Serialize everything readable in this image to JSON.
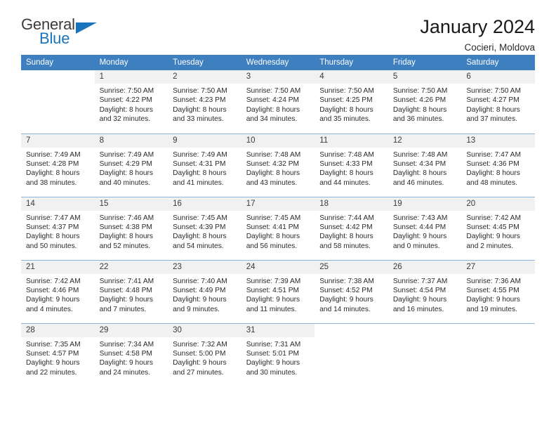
{
  "logo": {
    "word1": "General",
    "word2": "Blue",
    "triangle_color": "#1a74bb"
  },
  "header": {
    "title": "January 2024",
    "subtitle": "Cocieri, Moldova",
    "header_bg": "#3d7fbf",
    "daynum_bg": "#f1f1f1"
  },
  "weekdays": [
    "Sunday",
    "Monday",
    "Tuesday",
    "Wednesday",
    "Thursday",
    "Friday",
    "Saturday"
  ],
  "weeks": [
    [
      {
        "day": "",
        "blank": true,
        "sunrise": "",
        "sunset": "",
        "daylight1": "",
        "daylight2": ""
      },
      {
        "day": "1",
        "sunrise": "Sunrise: 7:50 AM",
        "sunset": "Sunset: 4:22 PM",
        "daylight1": "Daylight: 8 hours",
        "daylight2": "and 32 minutes."
      },
      {
        "day": "2",
        "sunrise": "Sunrise: 7:50 AM",
        "sunset": "Sunset: 4:23 PM",
        "daylight1": "Daylight: 8 hours",
        "daylight2": "and 33 minutes."
      },
      {
        "day": "3",
        "sunrise": "Sunrise: 7:50 AM",
        "sunset": "Sunset: 4:24 PM",
        "daylight1": "Daylight: 8 hours",
        "daylight2": "and 34 minutes."
      },
      {
        "day": "4",
        "sunrise": "Sunrise: 7:50 AM",
        "sunset": "Sunset: 4:25 PM",
        "daylight1": "Daylight: 8 hours",
        "daylight2": "and 35 minutes."
      },
      {
        "day": "5",
        "sunrise": "Sunrise: 7:50 AM",
        "sunset": "Sunset: 4:26 PM",
        "daylight1": "Daylight: 8 hours",
        "daylight2": "and 36 minutes."
      },
      {
        "day": "6",
        "sunrise": "Sunrise: 7:50 AM",
        "sunset": "Sunset: 4:27 PM",
        "daylight1": "Daylight: 8 hours",
        "daylight2": "and 37 minutes."
      }
    ],
    [
      {
        "day": "7",
        "sunrise": "Sunrise: 7:49 AM",
        "sunset": "Sunset: 4:28 PM",
        "daylight1": "Daylight: 8 hours",
        "daylight2": "and 38 minutes."
      },
      {
        "day": "8",
        "sunrise": "Sunrise: 7:49 AM",
        "sunset": "Sunset: 4:29 PM",
        "daylight1": "Daylight: 8 hours",
        "daylight2": "and 40 minutes."
      },
      {
        "day": "9",
        "sunrise": "Sunrise: 7:49 AM",
        "sunset": "Sunset: 4:31 PM",
        "daylight1": "Daylight: 8 hours",
        "daylight2": "and 41 minutes."
      },
      {
        "day": "10",
        "sunrise": "Sunrise: 7:48 AM",
        "sunset": "Sunset: 4:32 PM",
        "daylight1": "Daylight: 8 hours",
        "daylight2": "and 43 minutes."
      },
      {
        "day": "11",
        "sunrise": "Sunrise: 7:48 AM",
        "sunset": "Sunset: 4:33 PM",
        "daylight1": "Daylight: 8 hours",
        "daylight2": "and 44 minutes."
      },
      {
        "day": "12",
        "sunrise": "Sunrise: 7:48 AM",
        "sunset": "Sunset: 4:34 PM",
        "daylight1": "Daylight: 8 hours",
        "daylight2": "and 46 minutes."
      },
      {
        "day": "13",
        "sunrise": "Sunrise: 7:47 AM",
        "sunset": "Sunset: 4:36 PM",
        "daylight1": "Daylight: 8 hours",
        "daylight2": "and 48 minutes."
      }
    ],
    [
      {
        "day": "14",
        "sunrise": "Sunrise: 7:47 AM",
        "sunset": "Sunset: 4:37 PM",
        "daylight1": "Daylight: 8 hours",
        "daylight2": "and 50 minutes."
      },
      {
        "day": "15",
        "sunrise": "Sunrise: 7:46 AM",
        "sunset": "Sunset: 4:38 PM",
        "daylight1": "Daylight: 8 hours",
        "daylight2": "and 52 minutes."
      },
      {
        "day": "16",
        "sunrise": "Sunrise: 7:45 AM",
        "sunset": "Sunset: 4:39 PM",
        "daylight1": "Daylight: 8 hours",
        "daylight2": "and 54 minutes."
      },
      {
        "day": "17",
        "sunrise": "Sunrise: 7:45 AM",
        "sunset": "Sunset: 4:41 PM",
        "daylight1": "Daylight: 8 hours",
        "daylight2": "and 56 minutes."
      },
      {
        "day": "18",
        "sunrise": "Sunrise: 7:44 AM",
        "sunset": "Sunset: 4:42 PM",
        "daylight1": "Daylight: 8 hours",
        "daylight2": "and 58 minutes."
      },
      {
        "day": "19",
        "sunrise": "Sunrise: 7:43 AM",
        "sunset": "Sunset: 4:44 PM",
        "daylight1": "Daylight: 9 hours",
        "daylight2": "and 0 minutes."
      },
      {
        "day": "20",
        "sunrise": "Sunrise: 7:42 AM",
        "sunset": "Sunset: 4:45 PM",
        "daylight1": "Daylight: 9 hours",
        "daylight2": "and 2 minutes."
      }
    ],
    [
      {
        "day": "21",
        "sunrise": "Sunrise: 7:42 AM",
        "sunset": "Sunset: 4:46 PM",
        "daylight1": "Daylight: 9 hours",
        "daylight2": "and 4 minutes."
      },
      {
        "day": "22",
        "sunrise": "Sunrise: 7:41 AM",
        "sunset": "Sunset: 4:48 PM",
        "daylight1": "Daylight: 9 hours",
        "daylight2": "and 7 minutes."
      },
      {
        "day": "23",
        "sunrise": "Sunrise: 7:40 AM",
        "sunset": "Sunset: 4:49 PM",
        "daylight1": "Daylight: 9 hours",
        "daylight2": "and 9 minutes."
      },
      {
        "day": "24",
        "sunrise": "Sunrise: 7:39 AM",
        "sunset": "Sunset: 4:51 PM",
        "daylight1": "Daylight: 9 hours",
        "daylight2": "and 11 minutes."
      },
      {
        "day": "25",
        "sunrise": "Sunrise: 7:38 AM",
        "sunset": "Sunset: 4:52 PM",
        "daylight1": "Daylight: 9 hours",
        "daylight2": "and 14 minutes."
      },
      {
        "day": "26",
        "sunrise": "Sunrise: 7:37 AM",
        "sunset": "Sunset: 4:54 PM",
        "daylight1": "Daylight: 9 hours",
        "daylight2": "and 16 minutes."
      },
      {
        "day": "27",
        "sunrise": "Sunrise: 7:36 AM",
        "sunset": "Sunset: 4:55 PM",
        "daylight1": "Daylight: 9 hours",
        "daylight2": "and 19 minutes."
      }
    ],
    [
      {
        "day": "28",
        "sunrise": "Sunrise: 7:35 AM",
        "sunset": "Sunset: 4:57 PM",
        "daylight1": "Daylight: 9 hours",
        "daylight2": "and 22 minutes."
      },
      {
        "day": "29",
        "sunrise": "Sunrise: 7:34 AM",
        "sunset": "Sunset: 4:58 PM",
        "daylight1": "Daylight: 9 hours",
        "daylight2": "and 24 minutes."
      },
      {
        "day": "30",
        "sunrise": "Sunrise: 7:32 AM",
        "sunset": "Sunset: 5:00 PM",
        "daylight1": "Daylight: 9 hours",
        "daylight2": "and 27 minutes."
      },
      {
        "day": "31",
        "sunrise": "Sunrise: 7:31 AM",
        "sunset": "Sunset: 5:01 PM",
        "daylight1": "Daylight: 9 hours",
        "daylight2": "and 30 minutes."
      },
      {
        "day": "",
        "blank": true,
        "sunrise": "",
        "sunset": "",
        "daylight1": "",
        "daylight2": ""
      },
      {
        "day": "",
        "blank": true,
        "sunrise": "",
        "sunset": "",
        "daylight1": "",
        "daylight2": ""
      },
      {
        "day": "",
        "blank": true,
        "sunrise": "",
        "sunset": "",
        "daylight1": "",
        "daylight2": ""
      }
    ]
  ]
}
